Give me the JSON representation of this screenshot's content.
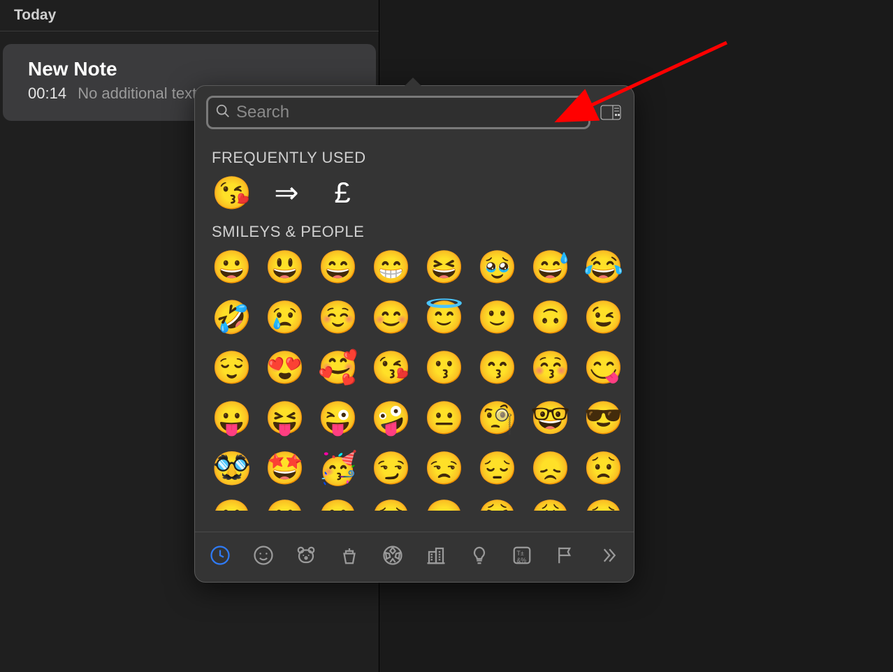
{
  "sidebar": {
    "section_header": "Today",
    "note": {
      "title": "New Note",
      "time": "00:14",
      "preview": "No additional text"
    }
  },
  "picker": {
    "search_placeholder": "Search",
    "expand_button": "expand-character-viewer",
    "sections": {
      "frequently_used": {
        "label": "FREQUENTLY USED",
        "items": [
          {
            "glyph": "😘",
            "name": "face-blowing-a-kiss"
          },
          {
            "glyph": "⇒",
            "name": "rightwards-double-arrow",
            "is_symbol": true
          },
          {
            "glyph": "£",
            "name": "pound-sign",
            "is_symbol": true
          }
        ]
      },
      "smileys_people": {
        "label": "SMILEYS & PEOPLE",
        "rows": [
          [
            "😀",
            "😃",
            "😄",
            "😁",
            "😆",
            "🥹",
            "😅",
            "😂"
          ],
          [
            "🤣",
            "😢",
            "☺️",
            "😊",
            "😇",
            "🙂",
            "🙃",
            "😉"
          ],
          [
            "😌",
            "😍",
            "🥰",
            "😘",
            "😗",
            "😙",
            "😚",
            "😋"
          ],
          [
            "😛",
            "😝",
            "😜",
            "🤪",
            "😐",
            "🧐",
            "🤓",
            "😎"
          ],
          [
            "🥸",
            "🤩",
            "🥳",
            "😏",
            "😒",
            "😔",
            "😞",
            "😟"
          ],
          [
            "😕",
            "🙁",
            "☹️",
            "😣",
            "😖",
            "😫",
            "😩",
            "🥺"
          ]
        ]
      }
    },
    "categories": [
      {
        "name": "frequently-used",
        "icon": "clock-icon",
        "active": true
      },
      {
        "name": "smileys-people",
        "icon": "smiley-icon"
      },
      {
        "name": "animals-nature",
        "icon": "bear-icon"
      },
      {
        "name": "food-drink",
        "icon": "cup-icon"
      },
      {
        "name": "activity",
        "icon": "soccer-icon"
      },
      {
        "name": "travel-places",
        "icon": "building-icon"
      },
      {
        "name": "objects",
        "icon": "lightbulb-icon"
      },
      {
        "name": "symbols",
        "icon": "symbols-icon"
      },
      {
        "name": "flags",
        "icon": "flag-icon"
      },
      {
        "name": "more",
        "icon": "chevron-right-icon"
      }
    ]
  },
  "annotation": {
    "arrow_color": "#ff0000"
  }
}
